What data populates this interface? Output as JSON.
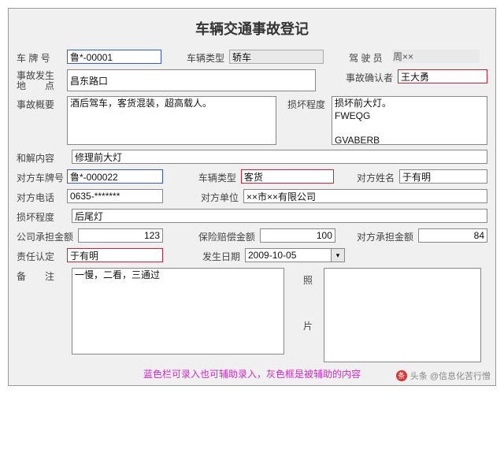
{
  "title": "车辆交通事故登记",
  "labels": {
    "plate_no": "车 牌  号",
    "vehicle_type": "车辆类型",
    "driver": "驾 驶 员",
    "accident_place": "事故发生\n地　　点",
    "confirmer": "事故确认者",
    "summary": "事故概要",
    "damage_level": "损坏程度",
    "settlement": "和解内容",
    "opp_plate": "对方车牌号",
    "opp_vehicle_type": "车辆类型",
    "opp_name": "对方姓名",
    "opp_phone": "对方电话",
    "opp_unit": "对方单位",
    "opp_damage": "损坏程度",
    "company_amount": "公司承担金额",
    "insurance_amount": "保险赔偿金额",
    "opp_amount": "对方承担金额",
    "responsible": "责任认定",
    "occur_date": "发生日期",
    "remark": "备　　注",
    "photo": "照\n\n片"
  },
  "values": {
    "plate_no": "鲁*-00001",
    "vehicle_type": "轿车",
    "driver": "周××",
    "accident_place": "昌东路口",
    "confirmer": "王大勇",
    "summary": "酒后驾车，客货混装，超高载人。",
    "damage_level": "损坏前大灯。\nFWEQG\n\nGVABERB",
    "settlement": "修理前大灯",
    "opp_plate": "鲁*-000022",
    "opp_vehicle_type": "客货",
    "opp_name": "于有明",
    "opp_phone": "0635-*******",
    "opp_unit": "××市××有限公司",
    "opp_damage": "后尾灯",
    "company_amount": "123",
    "insurance_amount": "100",
    "opp_amount": "84",
    "responsible": "于有明",
    "occur_date": "2009-10-05",
    "remark": "一慢，二看，三通过"
  },
  "hint": "蓝色栏可录入也可辅助录入，灰色框是被辅助的内容",
  "watermark": "头条 @信息化苦行憎"
}
